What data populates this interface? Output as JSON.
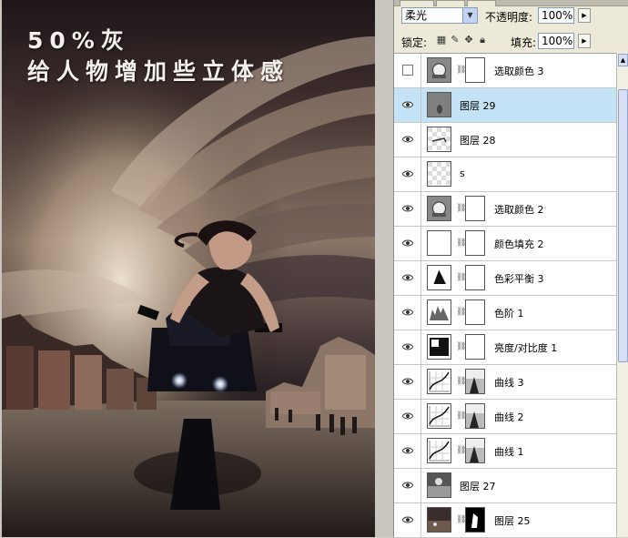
{
  "artwork": {
    "title_line1": "50%灰",
    "title_line2": "给人物增加些立体感"
  },
  "layers_panel": {
    "blend_mode": "柔光",
    "opacity_label": "不透明度:",
    "opacity_value": "100%",
    "lock_label": "锁定:",
    "fill_label": "填充:",
    "fill_value": "100%",
    "layers": [
      {
        "name": "选取颜色 3",
        "visible": false,
        "selected": false,
        "thumb": "adjust-selective-color",
        "mask": "white"
      },
      {
        "name": "图层 29",
        "visible": true,
        "selected": true,
        "thumb": "gray-layer",
        "mask": ""
      },
      {
        "name": "图层 28",
        "visible": true,
        "selected": false,
        "thumb": "transparent-stroke",
        "mask": ""
      },
      {
        "name": "s",
        "visible": true,
        "selected": false,
        "thumb": "transparent",
        "mask": ""
      },
      {
        "name": "选取颜色 2",
        "visible": true,
        "selected": false,
        "thumb": "adjust-selective-color",
        "mask": "white"
      },
      {
        "name": "颜色填充 2",
        "visible": true,
        "selected": false,
        "thumb": "white-fill",
        "mask": "white"
      },
      {
        "name": "色彩平衡 3",
        "visible": true,
        "selected": false,
        "thumb": "adjust-color-balance",
        "mask": "white"
      },
      {
        "name": "色阶 1",
        "visible": true,
        "selected": false,
        "thumb": "adjust-levels",
        "mask": "white"
      },
      {
        "name": "亮度/对比度 1",
        "visible": true,
        "selected": false,
        "thumb": "adjust-brightness",
        "mask": "white"
      },
      {
        "name": "曲线 3",
        "visible": true,
        "selected": false,
        "thumb": "adjust-curves",
        "mask": "photo"
      },
      {
        "name": "曲线 2",
        "visible": true,
        "selected": false,
        "thumb": "adjust-curves",
        "mask": "photo"
      },
      {
        "name": "曲线 1",
        "visible": true,
        "selected": false,
        "thumb": "adjust-curves",
        "mask": "photo"
      },
      {
        "name": "图层 27",
        "visible": true,
        "selected": false,
        "thumb": "photo-bw",
        "mask": ""
      },
      {
        "name": "图层 25",
        "visible": true,
        "selected": false,
        "thumb": "photo-color",
        "mask": "black-shape"
      }
    ]
  },
  "colors": {
    "selection": "#c4e3f6",
    "panel_bg": "#ece9d8",
    "sky_dark": "#2a1f22",
    "sky_light": "#d9c6b0"
  }
}
